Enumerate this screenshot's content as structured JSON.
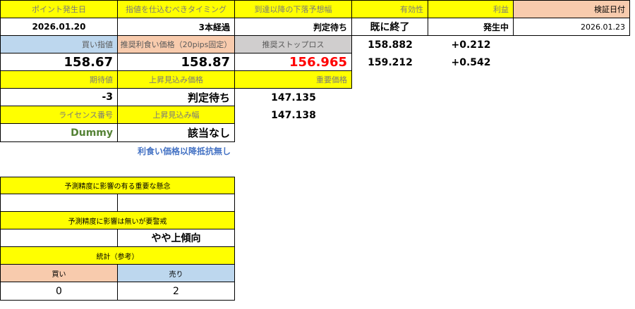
{
  "row1": {
    "h1": "ポイント発生日",
    "h2": "指値を仕込むべきタイミング",
    "h3": "到達以降の下落予想幅",
    "h4": "有効性",
    "h5": "利益",
    "h6": "検証日付"
  },
  "row2": {
    "date": "2026.01.20",
    "timing": "3本経過",
    "forecast": "判定待ち",
    "validity": "既に終了",
    "profit": "発生中",
    "verify_date": "2026.01.23"
  },
  "row3": {
    "buy_label": "買い指値",
    "tp_label": "推奨利食い価格（20pips固定）",
    "sl_label": "推奨ストップロス",
    "val_a": "158.882",
    "val_b": "+0.212"
  },
  "row4": {
    "buy": "158.67",
    "tp": "158.87",
    "sl": "156.965",
    "val_a": "159.212",
    "val_b": "+0.542"
  },
  "row5": {
    "expect_label": "期待値",
    "up_price_label": "上昇見込み価格",
    "key_price_label": "重要価格"
  },
  "row6": {
    "expect": "-3",
    "up_price": "判定待ち",
    "key1": "147.135"
  },
  "row7": {
    "license_label": "ライセンス番号",
    "up_range_label": "上昇見込み幅",
    "key2": "147.138"
  },
  "row8": {
    "license": "Dummy",
    "up_range": "該当なし"
  },
  "note": "利食い価格以降抵抗無し",
  "concern_label": "予測精度に影響の有る重要な懸念",
  "caution_label": "予測精度に影響は無いが要警戒",
  "caution_value": "やや上傾向",
  "stats_label": "統計（参考）",
  "stats": {
    "buy_label": "買い",
    "sell_label": "売り",
    "buy_count": "0",
    "sell_count": "2"
  }
}
